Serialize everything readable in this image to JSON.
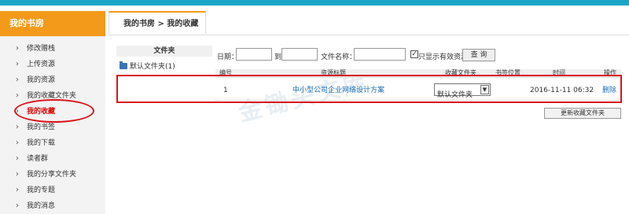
{
  "sidebar": {
    "title": "我的书房",
    "items": [
      {
        "label": "修改赠栈"
      },
      {
        "label": "上传资源"
      },
      {
        "label": "我的资源"
      },
      {
        "label": "我的收藏文件夹"
      },
      {
        "label": "我的收藏"
      },
      {
        "label": "我的书签"
      },
      {
        "label": "我的下载"
      },
      {
        "label": "读者群"
      },
      {
        "label": "我的分享文件夹"
      },
      {
        "label": "我的专题"
      },
      {
        "label": "我的消息"
      }
    ],
    "active_item": "我的收藏"
  },
  "tab": {
    "label": "我的书房 > 我的收藏"
  },
  "folder_panel": {
    "header": "文件夹",
    "items": [
      {
        "label": "默认文件夹(1)"
      }
    ]
  },
  "search": {
    "date_label": "日期：",
    "date_from": "",
    "to_label": "到",
    "date_to": "",
    "filename_label": "文件名称：",
    "filename": "",
    "checkbox_checked": true,
    "checkbox_label": "只显示有效资源",
    "button_label": "查 询"
  },
  "table": {
    "headers": {
      "index": "编号",
      "title": "资源标题",
      "folder": "收藏文件夹",
      "bookmark": "书签位置",
      "time": "时间",
      "action": "操作"
    },
    "rows": [
      {
        "index": "1",
        "title": "中小型公司企业网络设计方案",
        "folder": "默认文件夹",
        "bookmark": "",
        "time": "2016-11-11 06:32",
        "action": "删除"
      }
    ]
  },
  "update_button": "更新收藏文件夹",
  "watermark": "金锄头文库",
  "colors": {
    "accent_orange": "#f39a1a",
    "top_bar": "#1ba6c9",
    "annotation_red": "#d9141a",
    "link_blue": "#1a6fb4"
  }
}
